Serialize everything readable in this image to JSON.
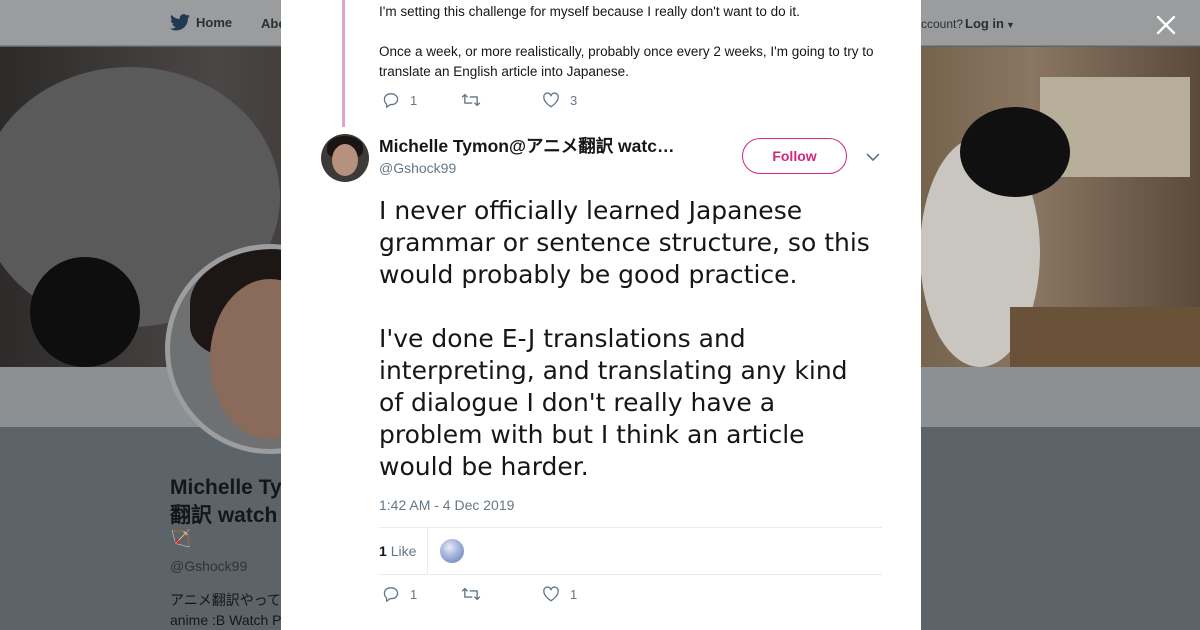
{
  "background_page": {
    "nav": {
      "home_label": "Home",
      "about_label": "Abo",
      "account_prompt": "ccount?",
      "login_label": "Log in"
    },
    "profile": {
      "name": "Michelle Ty",
      "name_line2": "翻訳 watch",
      "emoji": "🏹",
      "handle": "@Gshock99",
      "bio_line1": "アニメ翻訳やって",
      "bio_line2": "anime :B Watch P"
    }
  },
  "modal": {
    "previous_tweet": {
      "text": "I'm setting this challenge for myself because I really don't want to do it.\n\nOnce a week, or more realistically, probably once every 2 weeks, I'm going to try to translate an English article into Japanese.",
      "reply_count": "1",
      "retweet_count": "",
      "like_count": "3"
    },
    "tweet": {
      "display_name": "Michelle Tymon@アニメ翻訳 watc…",
      "screen_name": "@Gshock99",
      "follow_label": "Follow",
      "text": "I never officially learned Japanese grammar or sentence structure, so this would probably be good practice.\n\nI've done E-J translations and interpreting, and translating any kind of dialogue I don't really have a problem with but I think an article would be harder.",
      "timestamp": "1:42 AM - 4 Dec 2019",
      "likes_stat_count": "1",
      "likes_stat_label": "Like",
      "reply_count": "1",
      "retweet_count": "",
      "like_count": "1"
    }
  },
  "colors": {
    "accent": "#d1287c",
    "thread_line": "#e0a4c6",
    "muted": "#657786"
  }
}
